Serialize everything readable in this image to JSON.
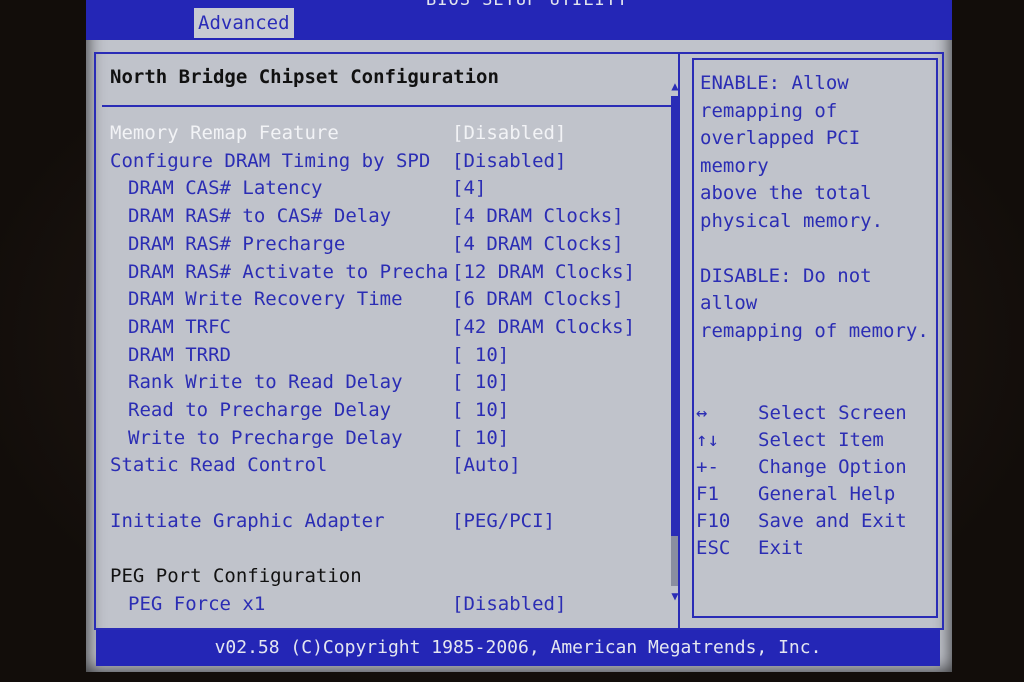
{
  "header": {
    "title": "BIOS SETUP UTILITY",
    "active_tab": "Advanced"
  },
  "panel": {
    "title": "North Bridge Chipset Configuration",
    "rows": [
      {
        "label": "Memory Remap Feature",
        "value": "[Disabled]",
        "selected": true,
        "indent": 0
      },
      {
        "label": "Configure DRAM Timing by SPD",
        "value": "[Disabled]",
        "indent": 0
      },
      {
        "label": "DRAM CAS# Latency",
        "value": "[4]",
        "indent": 1
      },
      {
        "label": "DRAM RAS# to CAS# Delay",
        "value": "[4 DRAM Clocks]",
        "indent": 1
      },
      {
        "label": "DRAM RAS# Precharge",
        "value": "[4 DRAM Clocks]",
        "indent": 1
      },
      {
        "label": "DRAM RAS# Activate to Precha",
        "value": "[12 DRAM Clocks]",
        "indent": 1
      },
      {
        "label": "DRAM Write Recovery Time",
        "value": "[6 DRAM Clocks]",
        "indent": 1
      },
      {
        "label": "DRAM TRFC",
        "value": "[42 DRAM Clocks]",
        "indent": 1
      },
      {
        "label": "DRAM TRRD",
        "value": "[ 10]",
        "indent": 1
      },
      {
        "label": "Rank Write to Read Delay",
        "value": "[ 10]",
        "indent": 1
      },
      {
        "label": "Read to Precharge Delay",
        "value": "[ 10]",
        "indent": 1
      },
      {
        "label": "Write to Precharge Delay",
        "value": "[ 10]",
        "indent": 1
      },
      {
        "label": "Static Read Control",
        "value": "[Auto]",
        "indent": 0
      },
      {
        "label": "",
        "value": "",
        "indent": 0
      },
      {
        "label": "Initiate Graphic Adapter",
        "value": "[PEG/PCI]",
        "indent": 0
      },
      {
        "label": "",
        "value": "",
        "indent": 0
      },
      {
        "label": "PEG Port Configuration",
        "value": "",
        "indent": 0,
        "section": true
      },
      {
        "label": "PEG Force x1",
        "value": "[Disabled]",
        "indent": 1
      }
    ]
  },
  "help": {
    "text": "ENABLE: Allow\nremapping of\noverlapped PCI memory\nabove the total\nphysical memory.\n\nDISABLE: Do not allow\nremapping of memory.",
    "keys": [
      {
        "key": "↔",
        "desc": "Select Screen"
      },
      {
        "key": "↑↓",
        "desc": "Select Item"
      },
      {
        "key": "+-",
        "desc": "Change Option"
      },
      {
        "key": "F1",
        "desc": "General Help"
      },
      {
        "key": "F10",
        "desc": "Save and Exit"
      },
      {
        "key": "ESC",
        "desc": "Exit"
      }
    ]
  },
  "footer": {
    "text": "v02.58 (C)Copyright 1985-2006, American Megatrends, Inc."
  },
  "colors": {
    "bios_blue": "#2426b6",
    "panel_grey": "#c0c3cb",
    "text_blue": "#2b2db4",
    "selected_text": "#f2f3f6"
  }
}
